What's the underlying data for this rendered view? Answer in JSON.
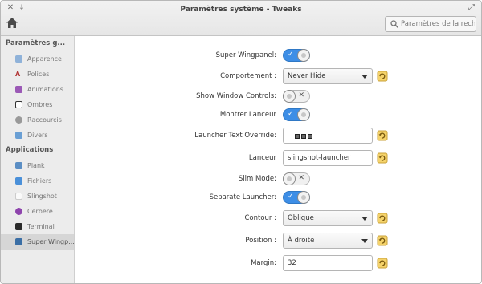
{
  "window": {
    "title": "Paramètres système - Tweaks",
    "close_glyph": "✕",
    "download_glyph": "⤓",
    "maximize_glyph": "⤢"
  },
  "header": {
    "search_placeholder": "Paramètres de la rech"
  },
  "sidebar": {
    "sections": [
      {
        "title": "Paramètres g...",
        "items": [
          {
            "label": "Apparence",
            "icon": "appearance-icon"
          },
          {
            "label": "Polices",
            "icon": "fonts-icon"
          },
          {
            "label": "Animations",
            "icon": "animations-icon"
          },
          {
            "label": "Ombres",
            "icon": "shadows-icon"
          },
          {
            "label": "Raccourcis",
            "icon": "shortcuts-icon"
          },
          {
            "label": "Divers",
            "icon": "misc-icon"
          }
        ]
      },
      {
        "title": "Applications",
        "items": [
          {
            "label": "Plank",
            "icon": "plank-icon"
          },
          {
            "label": "Fichiers",
            "icon": "files-icon"
          },
          {
            "label": "Slingshot",
            "icon": "slingshot-icon"
          },
          {
            "label": "Cerbere",
            "icon": "cerbere-icon"
          },
          {
            "label": "Terminal",
            "icon": "terminal-icon"
          },
          {
            "label": "Super Wingp...",
            "icon": "wingpanel-icon",
            "selected": true
          }
        ]
      }
    ]
  },
  "settings": {
    "super_wingpanel": {
      "label": "Super Wingpanel:",
      "on": true
    },
    "comportement": {
      "label": "Comportement :",
      "value": "Never Hide"
    },
    "show_window_controls": {
      "label": "Show Window Controls:",
      "on": false
    },
    "montrer_lanceur": {
      "label": "Montrer Lanceur",
      "on": true
    },
    "launcher_text_override": {
      "label": "Launcher Text Override:",
      "value": ""
    },
    "lanceur": {
      "label": "Lanceur",
      "value": "slingshot-launcher"
    },
    "slim_mode": {
      "label": "Slim Mode:",
      "on": false
    },
    "separate_launcher": {
      "label": "Separate Launcher:",
      "on": true
    },
    "contour": {
      "label": "Contour :",
      "value": "Oblique"
    },
    "position": {
      "label": "Position :",
      "value": "À droite"
    },
    "margin": {
      "label": "Margin:",
      "value": "32"
    }
  },
  "colors": {
    "accent": "#3d8ee6",
    "sidebar_bg": "#ececec",
    "selected_bg": "#d6d6d6"
  }
}
